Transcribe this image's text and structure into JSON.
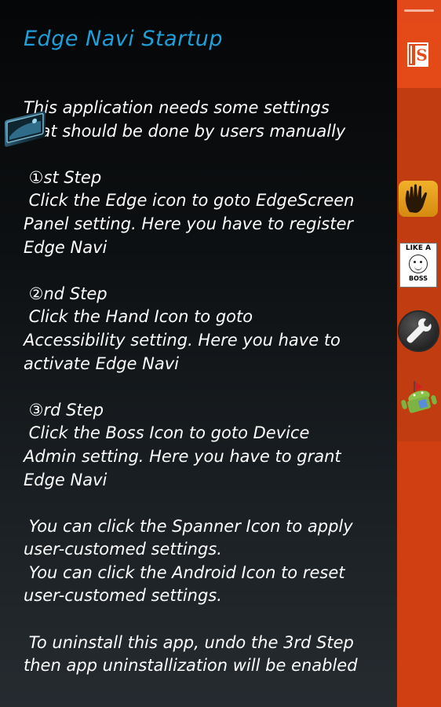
{
  "title": "Edge Navi Startup",
  "instructions": [
    "This application needs some settings",
    "that should be done by users manually",
    "",
    " ①st Step",
    " Click the Edge icon to goto EdgeScreen",
    "Panel setting. Here you have to register",
    "Edge Navi",
    "",
    " ②nd Step",
    " Click the Hand Icon to goto",
    "Accessibility setting. Here you have to",
    "activate Edge Navi",
    "",
    " ③rd Step",
    " Click the Boss Icon to goto Device",
    "Admin setting. Here you have to grant",
    "Edge Navi",
    "",
    " You can click the Spanner Icon to apply",
    "user-customed settings.",
    " You can click the Android Icon to reset",
    "user-customed settings.",
    "",
    " To uninstall this app, undo the 3rd Step",
    "then app uninstallization will be enabled"
  ],
  "edge_panel": {
    "s_icon_letter": "S",
    "boss_icon_top": "LIKE A",
    "boss_icon_bottom": "BOSS",
    "icons": [
      "s-app-icon",
      "edge-screen-icon",
      "hand-icon",
      "boss-icon",
      "spanner-icon",
      "android-icon"
    ]
  },
  "colors": {
    "title": "#1e9fd8",
    "edge_panel": "#cf3f12",
    "accent": "#e44a18",
    "text": "#ffffff"
  }
}
